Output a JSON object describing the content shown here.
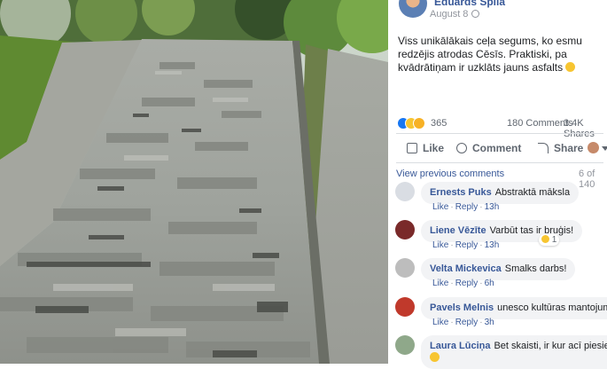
{
  "post": {
    "author": "Eduards Spila",
    "date": "August 8",
    "text": "Viss unikālākais ceļa segums, ko esmu redzējis atrodas Cēsīs. Praktiski, pa kvādrātiņam ir uzklāts jauns asfalts",
    "reaction_count": "365",
    "comments_count": "180 Comments",
    "shares_count": "3.4K Shares"
  },
  "actions": {
    "like": "Like",
    "comment": "Comment",
    "share": "Share"
  },
  "comments_header": {
    "view_previous": "View previous comments",
    "pager": "6 of 140"
  },
  "comment_meta": {
    "like": "Like",
    "reply": "Reply"
  },
  "comments": [
    {
      "name": "Ernests Puks",
      "text": "Abstraktā māksla",
      "time": "13h"
    },
    {
      "name": "Liene Vēzīte",
      "text": "Varbūt tas ir bruģis!",
      "time": "13h",
      "badge": "1"
    },
    {
      "name": "Velta Mickevica",
      "text": "Smalks darbs!",
      "time": "6h"
    },
    {
      "name": "Pavels Melnis",
      "text": "unesco kultūras mantojums",
      "time": "3h"
    },
    {
      "name": "Laura Lūciņa",
      "text": "Bet skaisti, ir kur acī piesiet"
    }
  ],
  "colors": {
    "link": "#385898",
    "bubble": "#f2f3f5",
    "like_blue": "#1877f2"
  }
}
